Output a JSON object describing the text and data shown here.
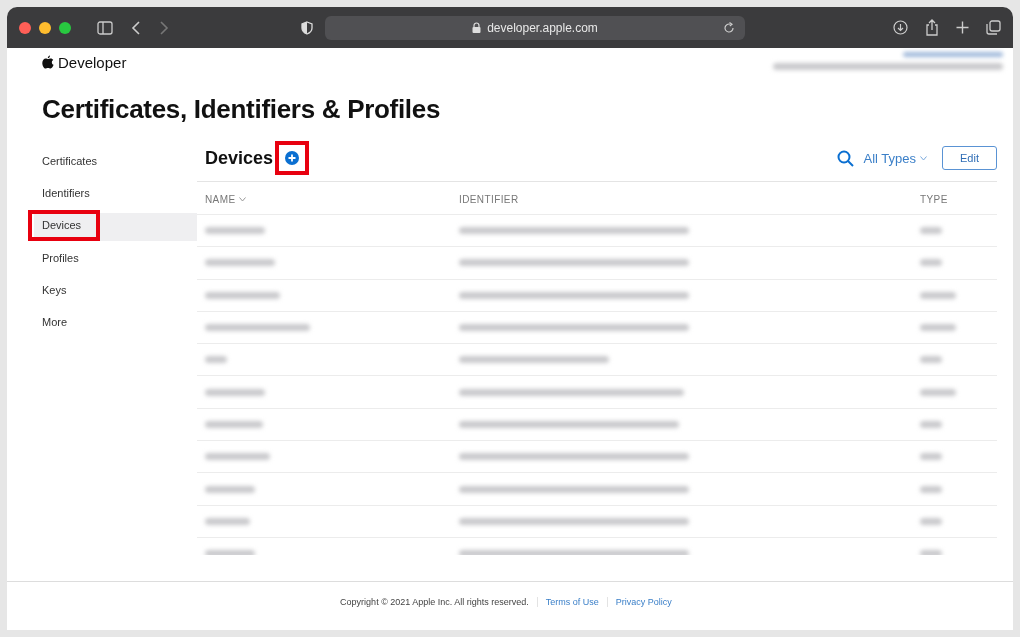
{
  "browser": {
    "url": "developer.apple.com"
  },
  "header": {
    "brand": "Developer"
  },
  "page_title": "Certificates, Identifiers & Profiles",
  "sidebar": {
    "items": [
      {
        "label": "Certificates",
        "selected": false,
        "highlighted": false
      },
      {
        "label": "Identifiers",
        "selected": false,
        "highlighted": false
      },
      {
        "label": "Devices",
        "selected": true,
        "highlighted": true
      },
      {
        "label": "Profiles",
        "selected": false,
        "highlighted": false
      },
      {
        "label": "Keys",
        "selected": false,
        "highlighted": false
      },
      {
        "label": "More",
        "selected": false,
        "highlighted": false
      }
    ]
  },
  "section": {
    "title": "Devices",
    "add_highlighted": true,
    "filter": "All Types",
    "edit": "Edit"
  },
  "table": {
    "columns": [
      {
        "label": "NAME",
        "sortable": true
      },
      {
        "label": "IDENTIFIER",
        "sortable": false
      },
      {
        "label": "TYPE",
        "sortable": false
      }
    ]
  },
  "footer": {
    "copyright": "Copyright © 2021 Apple Inc. All rights reserved.",
    "links": [
      "Terms of Use",
      "Privacy Policy"
    ]
  }
}
